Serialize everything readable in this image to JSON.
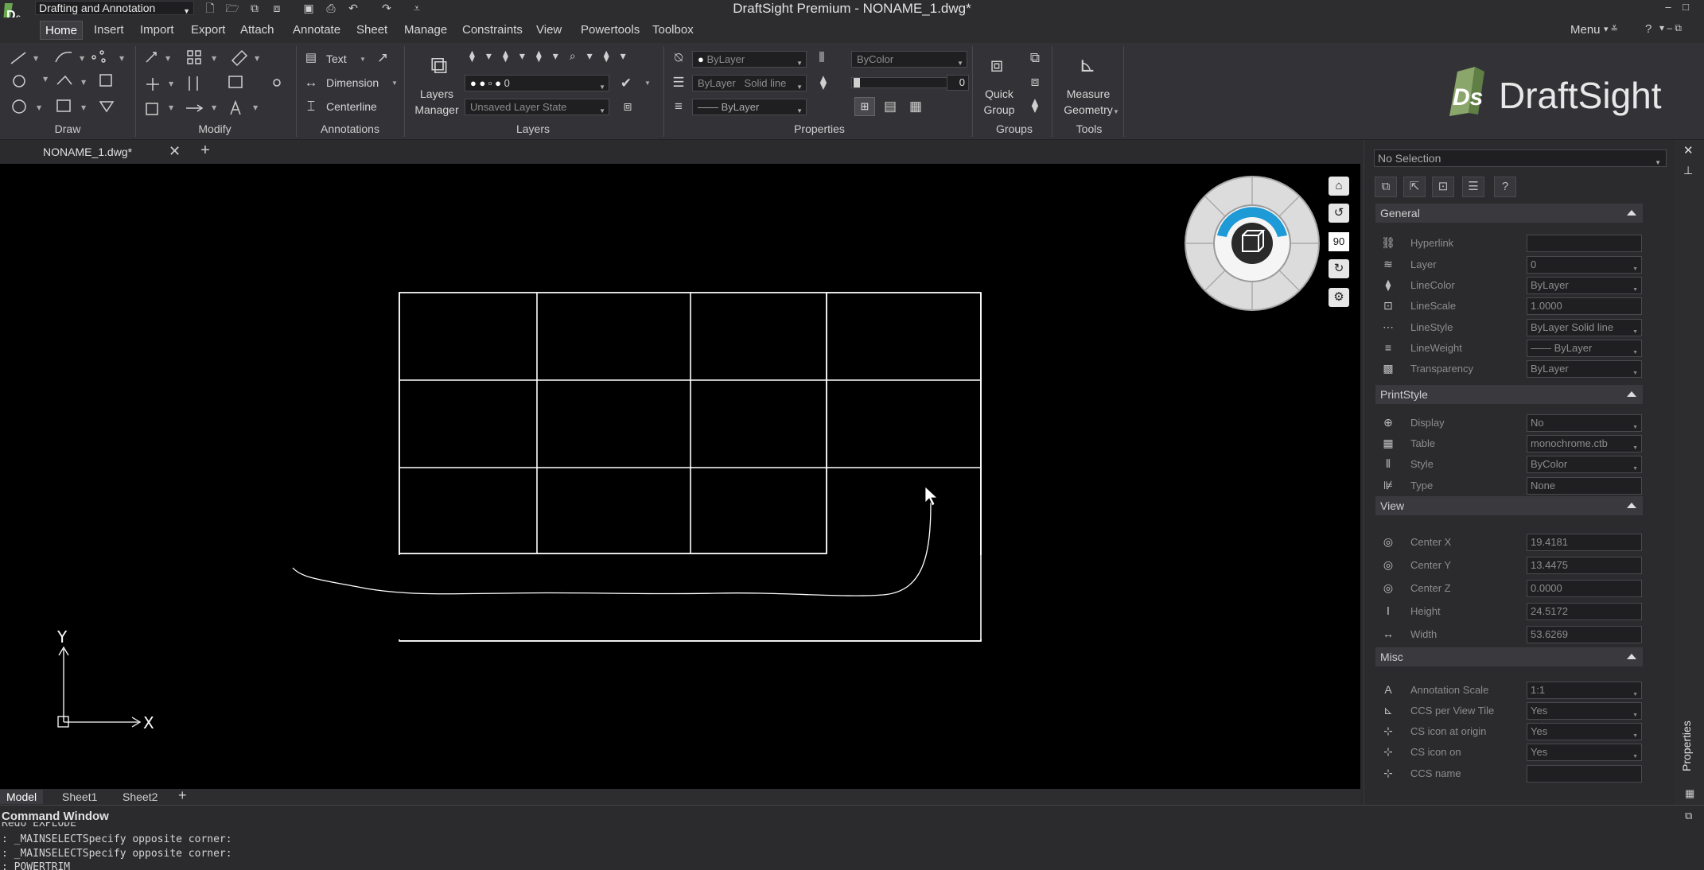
{
  "titlebar": {
    "workspace": "Drafting and Annotation",
    "window_title": "DraftSight Premium - NONAME_1.dwg*",
    "qat_icons": [
      "new-icon",
      "open-icon",
      "open-folder-icon",
      "open-recent-icon",
      "save-icon",
      "print-icon",
      "undo-icon",
      "redo-icon",
      "customize-icon"
    ]
  },
  "menu": {
    "tabs": [
      "Home",
      "Insert",
      "Import",
      "Export",
      "Attach",
      "Annotate",
      "Sheet",
      "Manage",
      "Constraints",
      "View",
      "Powertools",
      "Toolbox"
    ],
    "active_tab": "Home",
    "right_menu": "Menu"
  },
  "ribbon": {
    "groups": {
      "draw": "Draw",
      "modify": "Modify",
      "annotations": "Annotations",
      "layers": "Layers",
      "properties": "Properties",
      "groups": "Groups",
      "tools": "Tools"
    },
    "annotations": {
      "text": "Text",
      "dimension": "Dimension",
      "centerline": "Centerline"
    },
    "layers_manager": [
      "Layers",
      "Manager"
    ],
    "layer_current": "0",
    "layer_state": "Unsaved Layer State",
    "color": "ByLayer",
    "linestyle": "ByLayer",
    "linestyle_type": "Solid line",
    "lineweight": "ByLayer",
    "printstyle": "ByColor",
    "transparency_value": "0",
    "quick_group": [
      "Quick",
      "Group"
    ],
    "measure": [
      "Measure",
      "Geometry"
    ]
  },
  "brand": {
    "logo_text": "DraftSight",
    "logo_mark": "Ds"
  },
  "documents": {
    "tabs": [
      "NONAME_1.dwg*"
    ]
  },
  "viewcube": {
    "angle": "90"
  },
  "layout_tabs": [
    "Model",
    "Sheet1",
    "Sheet2"
  ],
  "command_window": {
    "title": "Command Window",
    "lines": [
      "Redo EXPLODE",
      ": _MAINSELECTSpecify opposite corner:",
      ": _MAINSELECTSpecify opposite corner:",
      ": POWERTRIM"
    ]
  },
  "properties": {
    "selection": "No Selection",
    "side_label": "Properties",
    "sections": [
      {
        "title": "General",
        "rows": [
          {
            "label": "Hyperlink",
            "value": "",
            "icon": "hyperlink-icon",
            "dropdown": false
          },
          {
            "label": "Layer",
            "value": "0",
            "icon": "layer-icon",
            "dropdown": true
          },
          {
            "label": "LineColor",
            "value": "ByLayer",
            "icon": "linecolor-icon",
            "dropdown": true
          },
          {
            "label": "LineScale",
            "value": "1.0000",
            "icon": "linescale-icon",
            "dropdown": false
          },
          {
            "label": "LineStyle",
            "value": "ByLayer     Solid line",
            "icon": "linestyle-icon",
            "dropdown": true
          },
          {
            "label": "LineWeight",
            "value": "—— ByLayer",
            "icon": "lineweight-icon",
            "dropdown": true
          },
          {
            "label": "Transparency",
            "value": "ByLayer",
            "icon": "transparency-icon",
            "dropdown": true
          }
        ]
      },
      {
        "title": "PrintStyle",
        "rows": [
          {
            "label": "Display",
            "value": "No",
            "icon": "display-icon",
            "dropdown": true
          },
          {
            "label": "Table",
            "value": "monochrome.ctb",
            "icon": "table-icon",
            "dropdown": true
          },
          {
            "label": "Style",
            "value": "ByColor",
            "icon": "style-icon",
            "dropdown": true
          },
          {
            "label": "Type",
            "value": "None",
            "icon": "type-icon",
            "dropdown": false
          }
        ]
      },
      {
        "title": "View",
        "rows": [
          {
            "label": "Center X",
            "value": "19.4181",
            "icon": "center-icon",
            "dropdown": false
          },
          {
            "label": "Center Y",
            "value": "13.4475",
            "icon": "center-icon",
            "dropdown": false
          },
          {
            "label": "Center Z",
            "value": "0.0000",
            "icon": "center-icon",
            "dropdown": false
          },
          {
            "label": "Height",
            "value": "24.5172",
            "icon": "height-icon",
            "dropdown": false
          },
          {
            "label": "Width",
            "value": "53.6269",
            "icon": "width-icon",
            "dropdown": false
          }
        ]
      },
      {
        "title": "Misc",
        "rows": [
          {
            "label": "Annotation Scale",
            "value": "1:1",
            "icon": "annotation-scale-icon",
            "dropdown": true
          },
          {
            "label": "CCS per View Tile",
            "value": "Yes",
            "icon": "ccs-icon",
            "dropdown": true
          },
          {
            "label": "CS icon at origin",
            "value": "Yes",
            "icon": "cs-origin-icon",
            "dropdown": true
          },
          {
            "label": "CS icon on",
            "value": "Yes",
            "icon": "cs-on-icon",
            "dropdown": true
          },
          {
            "label": "CCS name",
            "value": "",
            "icon": "ccs-name-icon",
            "dropdown": false
          }
        ]
      }
    ]
  },
  "ucs": {
    "x_label": "X",
    "y_label": "Y"
  },
  "colors": {
    "canvas": "#000000",
    "accent": "#1e9ad6",
    "ui_bg": "#2b2b2e"
  }
}
